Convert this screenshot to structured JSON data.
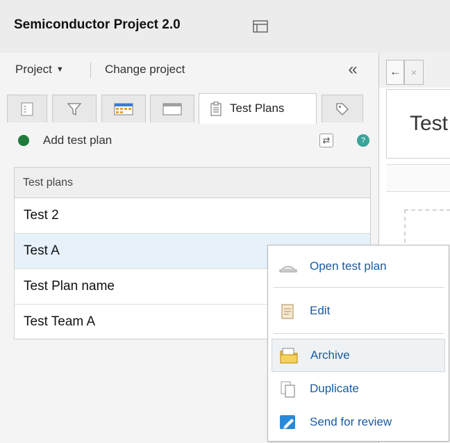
{
  "app": {
    "title": "Semiconductor Project 2.0"
  },
  "project_bar": {
    "project_menu": "Project",
    "change_project": "Change project",
    "collapse": "«"
  },
  "tabs": [
    {
      "icon": "list-view-icon"
    },
    {
      "icon": "filter-icon"
    },
    {
      "icon": "calendar-grid-icon"
    },
    {
      "icon": "window-icon"
    },
    {
      "icon": "clipboard-icon",
      "label": "Test Plans",
      "active": true
    },
    {
      "icon": "tag-icon"
    }
  ],
  "toolbar": {
    "add_label": "Add test plan",
    "help_glyph": "?"
  },
  "list": {
    "header": "Test plans",
    "rows": [
      "Test 2",
      "Test A",
      "Test Plan name",
      "Test Team A"
    ],
    "selected_index": 1
  },
  "right_panel": {
    "title_fragment": "Test",
    "nav_back": "←",
    "close": "×"
  },
  "context_menu": {
    "items": [
      {
        "label": "Open test plan",
        "icon": "open-tray-icon"
      },
      {
        "label": "Edit",
        "icon": "edit-note-icon"
      },
      {
        "label": "Archive",
        "icon": "archive-folder-icon",
        "hover": true
      },
      {
        "label": "Duplicate",
        "icon": "duplicate-icon"
      },
      {
        "label": "Send for review",
        "icon": "send-review-icon"
      }
    ]
  },
  "colors": {
    "accent_green": "#1f7a3a",
    "menu_link": "#1a5aa0",
    "selected_row": "#e6f1f9",
    "help_teal": "#3aa39a"
  }
}
